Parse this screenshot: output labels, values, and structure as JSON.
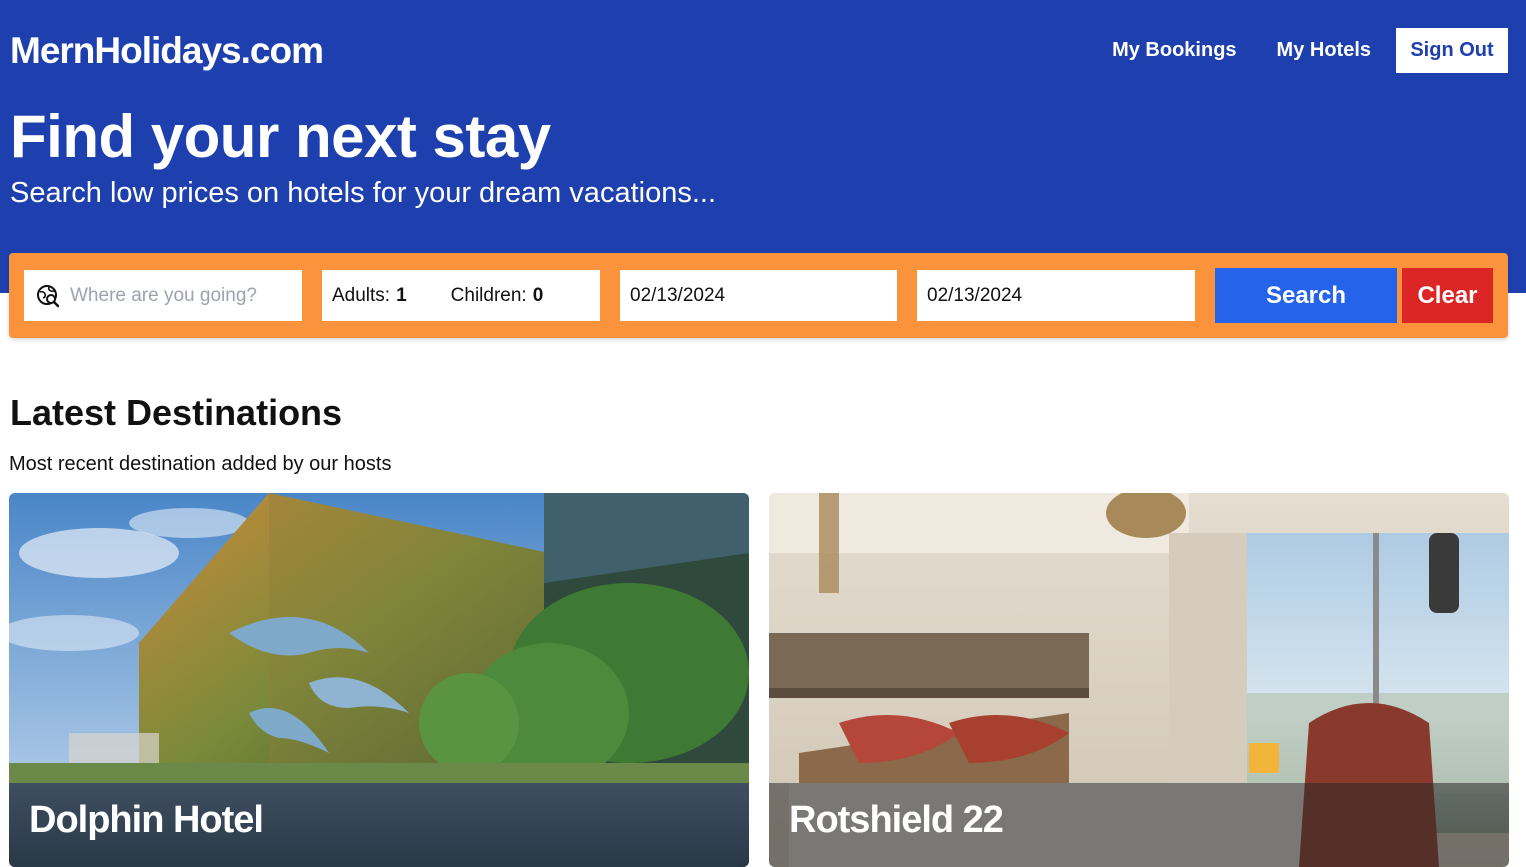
{
  "header": {
    "logo": "MernHolidays.com",
    "nav": {
      "bookings": "My Bookings",
      "hotels": "My Hotels",
      "sign_out": "Sign Out"
    },
    "title": "Find your next stay",
    "subtitle": "Search low prices on hotels for your dream vacations..."
  },
  "search": {
    "destination_placeholder": "Where are you going?",
    "destination_value": "",
    "adults_label": "Adults:",
    "adults_value": "1",
    "children_label": "Children:",
    "children_value": "0",
    "check_in": "02/13/2024",
    "check_out": "02/13/2024",
    "search_button": "Search",
    "clear_button": "Clear"
  },
  "latest": {
    "title": "Latest Destinations",
    "subtitle": "Most recent destination added by our hosts",
    "hotels": [
      {
        "name": "Dolphin Hotel",
        "image": "hotel-exterior-with-dolphin-fountain"
      },
      {
        "name": "Rotshield 22",
        "image": "hotel-room-bed-with-window-view"
      }
    ]
  },
  "colors": {
    "brand_blue": "#1e40af",
    "search_bar_orange": "#fb923c",
    "search_button": "#2563eb",
    "clear_button": "#dc2626"
  }
}
